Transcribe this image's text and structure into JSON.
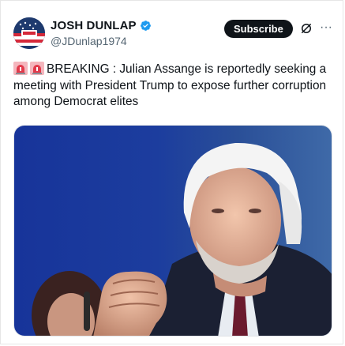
{
  "author": {
    "display_name": "JOSH DUNLAP",
    "handle": "@JDunlap1974",
    "verified": true,
    "avatar_icon": "flag-avatar-icon"
  },
  "actions": {
    "subscribe_label": "Subscribe",
    "grok_icon": "grok-icon",
    "more_icon": "more-icon"
  },
  "post": {
    "text": "BREAKING : Julian Assange is reportedly seeking a meeting with President Trump to expose further corruption among Democrat elites",
    "leading_icons": [
      "siren-icon",
      "siren-icon"
    ]
  },
  "media": {
    "type": "photo",
    "subject": "photo"
  },
  "colors": {
    "accent": "#1d9bf0",
    "button_bg": "#0f1419",
    "muted": "#536471"
  }
}
